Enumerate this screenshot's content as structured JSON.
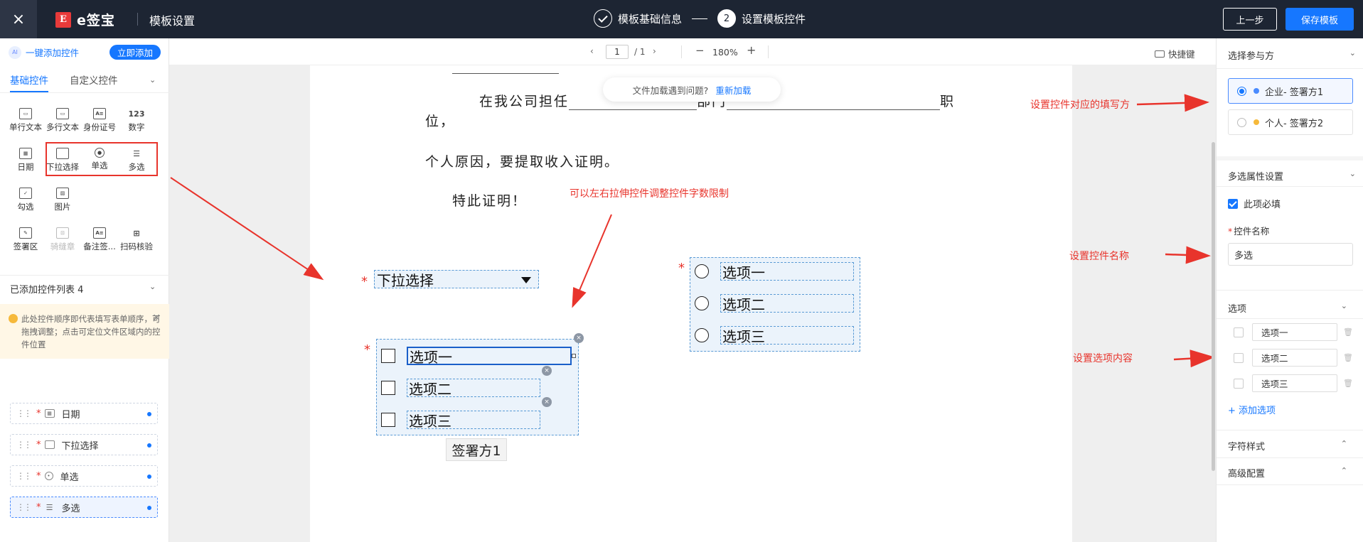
{
  "topbar": {
    "close_icon": "×",
    "logo_mark": "E",
    "logo_text": "e签宝",
    "title": "模板设置",
    "step1_label": "模板基础信息",
    "step2_number": "2",
    "step2_label": "设置模板控件",
    "prev_label": "上一步",
    "save_label": "保存模板"
  },
  "left": {
    "ai_badge": "AI",
    "quick_add_label": "一键添加控件",
    "quick_add_button": "立即添加",
    "tabs": [
      "基础控件",
      "自定义控件"
    ],
    "controls": [
      {
        "label": "单行文本",
        "icon": "▭",
        "icon_name": "single-line-text-icon"
      },
      {
        "label": "多行文本",
        "icon": "▭",
        "icon_name": "multi-line-text-icon"
      },
      {
        "label": "身份证号",
        "icon": "A≡",
        "icon_name": "id-card-icon"
      },
      {
        "label": "数字",
        "icon": "123",
        "icon_name": "number-icon"
      },
      {
        "label": "日期",
        "icon": "▦",
        "icon_name": "calendar-icon"
      },
      {
        "label": "下拉选择",
        "icon": "▭",
        "icon_name": "dropdown-icon"
      },
      {
        "label": "单选",
        "icon": "◉",
        "icon_name": "radio-icon"
      },
      {
        "label": "多选",
        "icon": "☰",
        "icon_name": "checklist-icon"
      },
      {
        "label": "勾选",
        "icon": "✓",
        "icon_name": "checkbox-icon"
      },
      {
        "label": "图片",
        "icon": "▨",
        "icon_name": "image-icon"
      },
      {
        "label": "签署区",
        "icon": "✎",
        "icon_name": "signature-area-icon"
      },
      {
        "label": "骑缝章",
        "icon": "⊡",
        "icon_name": "seam-seal-icon"
      },
      {
        "label": "备注签...",
        "icon": "A≡",
        "icon_name": "remark-sign-icon"
      },
      {
        "label": "扫码核验",
        "icon": "⊞",
        "icon_name": "qr-verify-icon"
      }
    ],
    "added_title": "已添加控件列表 4",
    "tip": "此处控件顺序即代表填写表单顺序，可拖拽调整；点击可定位文件区域内的控件位置",
    "added_items": [
      {
        "label": "日期",
        "icon": "▦"
      },
      {
        "label": "下拉选择",
        "icon": "▭"
      },
      {
        "label": "单选",
        "icon": "◉"
      },
      {
        "label": "多选",
        "icon": "☰"
      }
    ]
  },
  "toolbar": {
    "page_current": "1",
    "page_total": "/ 1",
    "zoom": "180%",
    "shortcut_label": "快捷键"
  },
  "doc": {
    "line1_a": "在我公司担任",
    "line1_b": "部门",
    "line1_c": "职",
    "line2": "位，",
    "line3": "个人原因，要提取收入证明。",
    "line4": "特此证明！",
    "toast_text": "文件加载遇到问题?",
    "toast_link": "重新加载",
    "dropdown_value": "下拉选择",
    "checkbox_options": [
      "选项一",
      "选项二",
      "选项三"
    ],
    "radio_options": [
      "选项一",
      "选项二",
      "选项三"
    ],
    "signer_tag": "签署方1",
    "required_mark": "*"
  },
  "annotations": {
    "stretch": "可以左右拉伸控件调整控件字数限制",
    "party": "设置控件对应的填写方",
    "name": "设置控件名称",
    "options": "设置选项内容",
    "color": "#e8342c"
  },
  "right": {
    "party_title": "选择参与方",
    "parties": [
      {
        "label": "企业- 签署方1",
        "dot": "#4a8bff"
      },
      {
        "label": "个人- 签署方2",
        "dot": "#f6b93b"
      }
    ],
    "attr_title": "多选属性设置",
    "required_label": "此项必填",
    "name_label": "控件名称",
    "name_value": "多选",
    "options_title": "选项",
    "options": [
      "选项一",
      "选项二",
      "选项三"
    ],
    "add_option": "+ 添加选项",
    "font_style": "字符样式",
    "advanced": "高级配置"
  },
  "colors": {
    "accent": "#1677ff",
    "topbar": "#1d2533",
    "control_fill": "#ebf3fb"
  }
}
